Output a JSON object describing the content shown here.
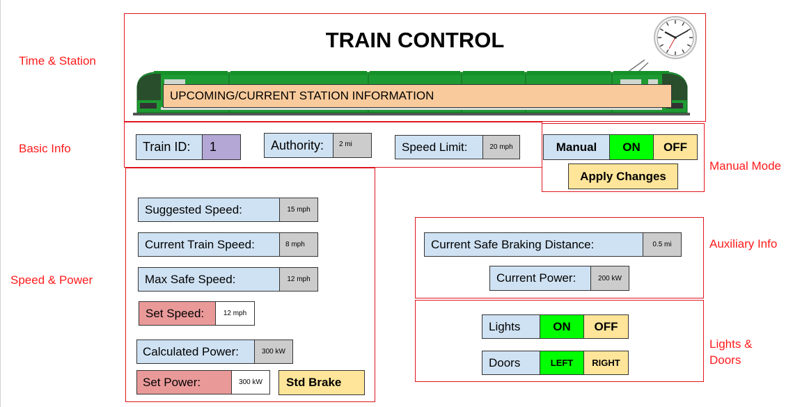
{
  "side_labels": {
    "time_station": "Time & Station",
    "basic_info": "Basic Info",
    "speed_power": "Speed & Power",
    "manual_mode": "Manual Mode",
    "auxiliary_info": "Auxiliary Info",
    "lights_doors_line1": "Lights &",
    "lights_doors_line2": "Doors"
  },
  "header": {
    "title": "TRAIN CONTROL",
    "station_info": "UPCOMING/CURRENT STATION INFORMATION"
  },
  "basic_info": {
    "train_id_label": "Train ID:",
    "train_id_value": "1",
    "authority_label": "Authority:",
    "authority_value": "2 mi",
    "speed_limit_label": "Speed Limit:",
    "speed_limit_value": "20 mph"
  },
  "manual_mode": {
    "label": "Manual",
    "on": "ON",
    "off": "OFF",
    "apply": "Apply Changes"
  },
  "speed_power": {
    "suggested_label": "Suggested Speed:",
    "suggested_value": "15 mph",
    "current_label": "Current Train Speed:",
    "current_value": "8 mph",
    "max_safe_label": "Max Safe Speed:",
    "max_safe_value": "12 mph",
    "set_speed_label": "Set Speed:",
    "set_speed_value": "12 mph",
    "calc_power_label": "Calculated Power:",
    "calc_power_value": "300 kW",
    "set_power_label": "Set Power:",
    "set_power_value": "300 kW",
    "brake_label": "Std Brake"
  },
  "auxiliary": {
    "braking_label": "Current Safe Braking Distance:",
    "braking_value": "0.5 mi",
    "power_label": "Current Power:",
    "power_value": "200 kW"
  },
  "lights_doors": {
    "lights_label": "Lights",
    "lights_on": "ON",
    "lights_off": "OFF",
    "doors_label": "Doors",
    "doors_left": "LEFT",
    "doors_right": "RIGHT"
  },
  "colors": {
    "frame_red": "#e0141e",
    "label_text_red": "#ff1a1a",
    "label_blue": "#cfe2f3",
    "label_red": "#ea9999",
    "button_yellow": "#ffe599",
    "on_green": "#00ff00",
    "value_gray": "#cccccc",
    "id_purple": "#b4a7d6",
    "station_orange": "#f9cb9c",
    "train_green": "#1e9a32"
  }
}
